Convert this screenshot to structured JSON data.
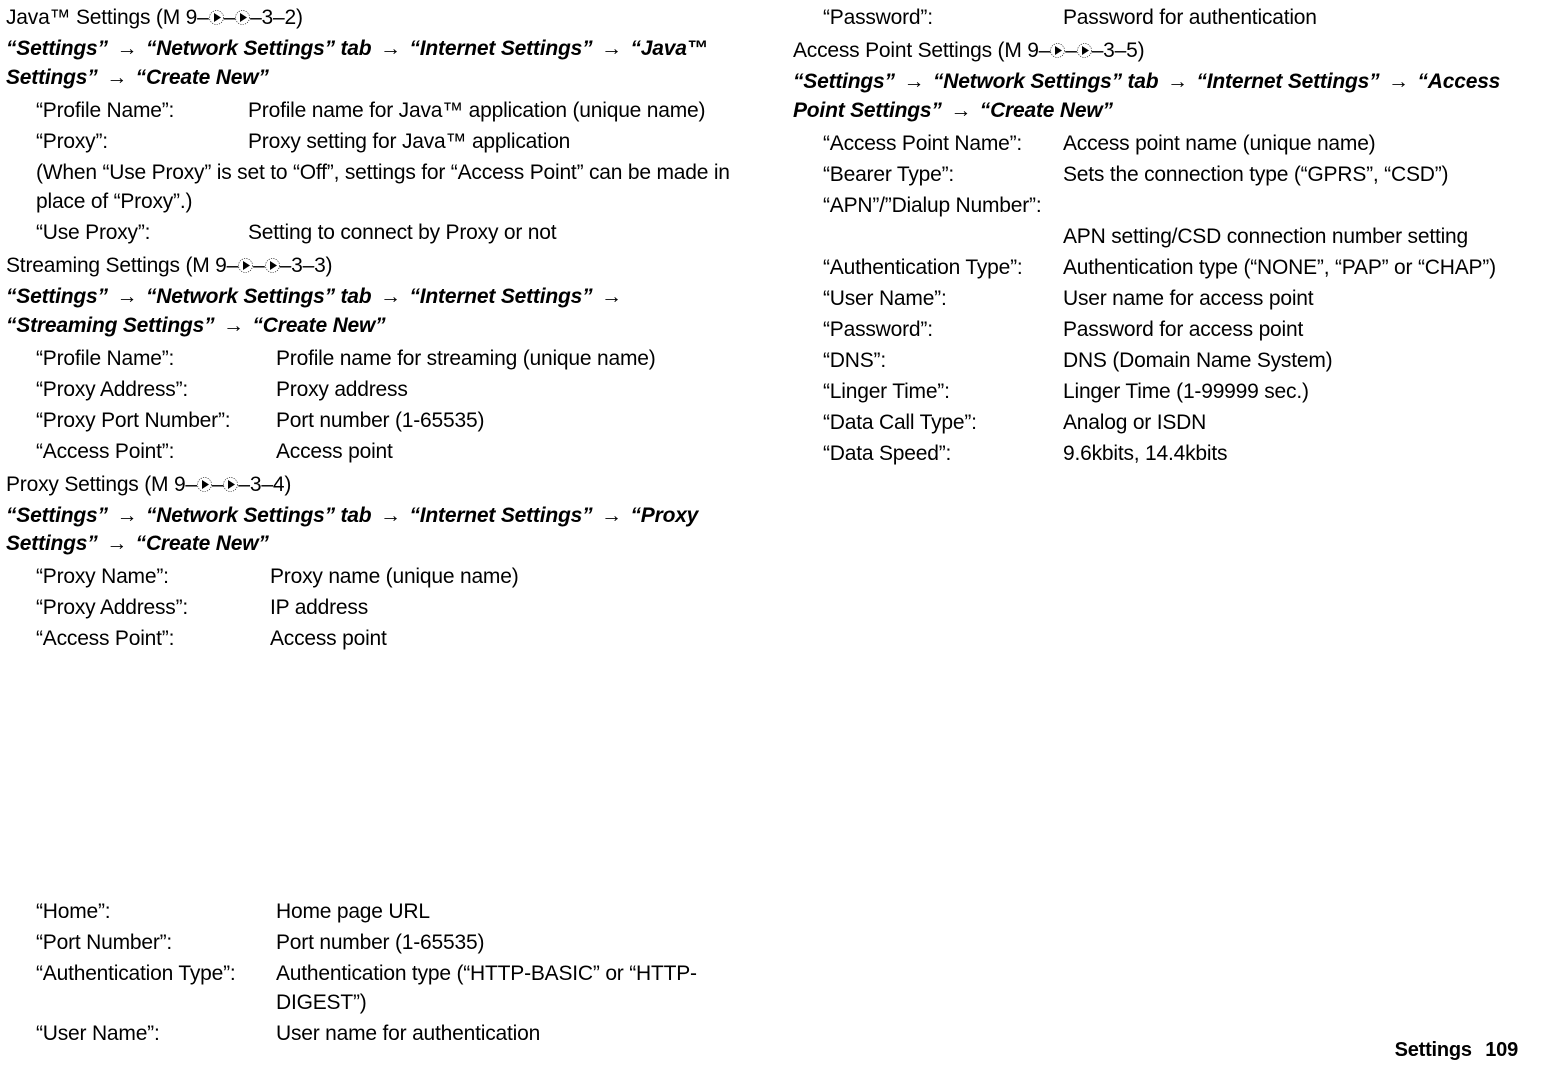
{
  "glyphs": {
    "arrow": "→"
  },
  "sections": {
    "java": {
      "title_pre": "Java™ Settings (M 9–",
      "title_mid": "–",
      "title_post": "–3–2)",
      "nav": [
        "“Settings”",
        "“Network Settings” tab",
        "“Internet Settings”",
        "“Java™ Settings”",
        "“Create New”"
      ],
      "rows": [
        {
          "label": "“Profile Name”:",
          "desc": "Profile name for Java™ application (unique name)"
        },
        {
          "label": "“Proxy”:",
          "desc": "Proxy setting for Java™ application"
        }
      ],
      "note": "(When “Use Proxy” is set to “Off”, settings for “Access Point” can be made in place of “Proxy”.)",
      "rows2": [
        {
          "label": "“Use Proxy”:",
          "desc": "Setting to connect by Proxy or not"
        }
      ]
    },
    "streaming": {
      "title_pre": "Streaming Settings (M 9–",
      "title_mid": "–",
      "title_post": "–3–3)",
      "nav": [
        "“Settings”",
        "“Network Settings” tab",
        "“Internet Settings”",
        "“Streaming Settings”",
        "“Create New”"
      ],
      "rows": [
        {
          "label": "“Profile Name”:",
          "desc": "Profile name for streaming (unique name)"
        },
        {
          "label": "“Proxy Address”:",
          "desc": "Proxy address"
        },
        {
          "label": "“Proxy Port Number”:",
          "desc": "Port number (1-65535)"
        },
        {
          "label": "“Access Point”:",
          "desc": "Access point"
        }
      ]
    },
    "proxy": {
      "title_pre": "Proxy Settings (M 9–",
      "title_mid": "–",
      "title_post": "–3–4)",
      "nav": [
        "“Settings”",
        "“Network Settings” tab",
        "“Internet Settings”",
        "“Proxy Settings”",
        "“Create New”"
      ],
      "rows": [
        {
          "label": "“Proxy Name”:",
          "desc": "Proxy name (unique name)"
        },
        {
          "label": "“Proxy Address”:",
          "desc": "IP address"
        },
        {
          "label": "“Access Point”:",
          "desc": "Access point"
        }
      ],
      "rows_col2": [
        {
          "label": "“Home”:",
          "desc": "Home page URL"
        },
        {
          "label": "“Port Number”:",
          "desc": "Port number (1-65535)"
        },
        {
          "label": "“Authentication Type”:",
          "desc": "Authentication type (“HTTP-BASIC” or “HTTP-DIGEST”)"
        },
        {
          "label": "“User Name”:",
          "desc": "User name for authentication"
        },
        {
          "label": "“Password”:",
          "desc": "Password for authentication"
        }
      ]
    },
    "ap": {
      "title_pre": "Access Point Settings (M 9–",
      "title_mid": "–",
      "title_post": "–3–5)",
      "nav": [
        "“Settings”",
        "“Network Settings” tab",
        "“Internet Settings”",
        "“Access Point Settings”",
        "“Create New”"
      ],
      "rows": [
        {
          "label": "“Access Point Name”:",
          "desc": "Access point name (unique name)"
        },
        {
          "label": "“Bearer Type”:",
          "desc": "Sets the connection type (“GPRS”, “CSD”)"
        }
      ],
      "apn_label": "“APN”/”Dialup Number”:",
      "apn_desc": "APN setting/CSD connection number setting",
      "rows2": [
        {
          "label": "“Authentication Type”:",
          "desc": "Authentication type (“NONE”, “PAP” or “CHAP”)"
        },
        {
          "label": "“User Name”:",
          "desc": "User name for access point"
        },
        {
          "label": "“Password”:",
          "desc": "Password for access point"
        },
        {
          "label": "“DNS”:",
          "desc": "DNS (Domain Name System)"
        },
        {
          "label": "“Linger Time”:",
          "desc": "Linger Time (1-99999 sec.)"
        },
        {
          "label": "“Data Call Type”:",
          "desc": "Analog or ISDN"
        },
        {
          "label": "“Data Speed”:",
          "desc": "9.6kbits, 14.4kbits"
        }
      ]
    }
  },
  "footer": {
    "title": "Settings",
    "page": "109"
  }
}
